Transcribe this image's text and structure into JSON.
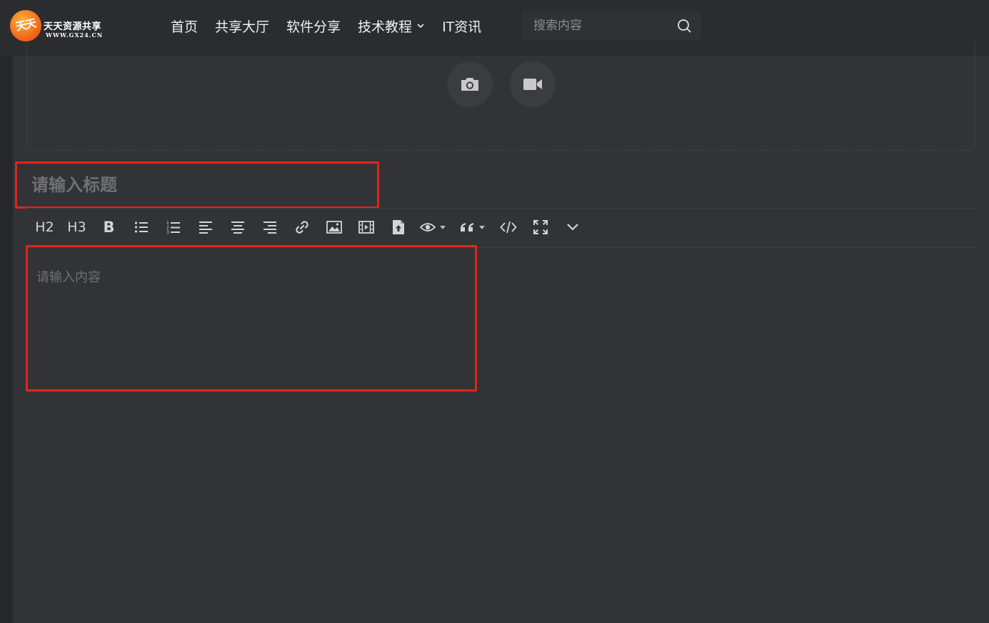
{
  "header": {
    "logo": {
      "mark": "天天",
      "title": "天天资源共享",
      "subtitle": "WWW.GX24.CN"
    },
    "nav": [
      {
        "label": "首页",
        "has_dropdown": false
      },
      {
        "label": "共享大厅",
        "has_dropdown": false
      },
      {
        "label": "软件分享",
        "has_dropdown": false
      },
      {
        "label": "技术教程",
        "has_dropdown": true
      },
      {
        "label": "IT资讯",
        "has_dropdown": false
      }
    ],
    "search": {
      "placeholder": "搜索内容",
      "icon": "search-icon"
    }
  },
  "upload": {
    "buttons": [
      {
        "icon": "camera-icon"
      },
      {
        "icon": "video-camera-icon"
      }
    ]
  },
  "editor": {
    "title_placeholder": "请输入标题",
    "content_placeholder": "请输入内容",
    "toolbar": {
      "h2_label": "H2",
      "h3_label": "H3",
      "bold_label": "B",
      "icons": [
        "unordered-list-icon",
        "ordered-list-icon",
        "align-left-icon",
        "align-center-icon",
        "align-right-icon",
        "link-icon",
        "image-icon",
        "video-icon",
        "file-upload-icon",
        "eye-icon",
        "quote-icon",
        "code-icon",
        "fullscreen-icon",
        "chevron-down-icon"
      ]
    }
  },
  "colors": {
    "highlight_border": "#e1251b",
    "panel_bg": "#323336",
    "header_bg": "#2b2c2f"
  }
}
